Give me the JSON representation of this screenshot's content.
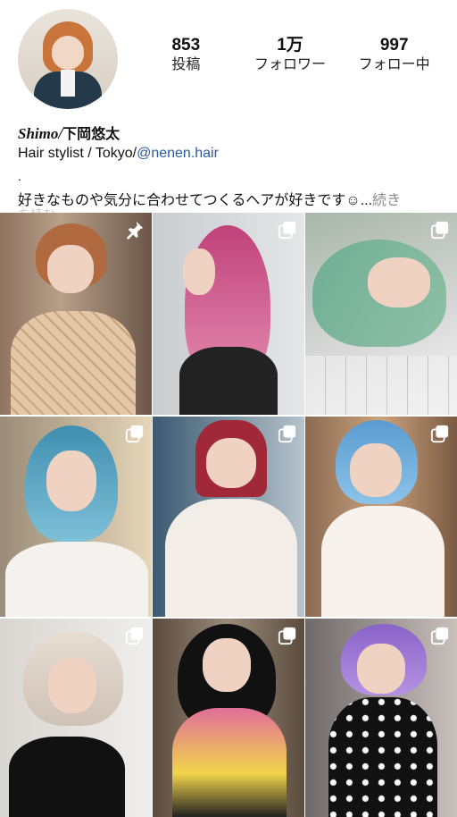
{
  "profile": {
    "stats": [
      {
        "value": "853",
        "label": "投稿"
      },
      {
        "value": "1万",
        "label": "フォロワー"
      },
      {
        "value": "997",
        "label": "フォロー中"
      }
    ],
    "name_latin": "Shimo/",
    "name_jp": "下岡悠太",
    "bio_line1_prefix": "Hair stylist / Tokyo/",
    "bio_line1_link": "@nenen.hair",
    "bio_dot": ".",
    "bio_line2": "好きなものや気分に合わせてつくるヘアが好きです☺︎...",
    "more_label": "続き",
    "cutoff_text": "を読む"
  },
  "grid": {
    "tiles": [
      {
        "icon": "pin-icon"
      },
      {
        "icon": "multi-photo-icon"
      },
      {
        "icon": "multi-photo-icon"
      },
      {
        "icon": "multi-photo-icon"
      },
      {
        "icon": "multi-photo-icon"
      },
      {
        "icon": "multi-photo-icon"
      },
      {
        "icon": "multi-photo-icon"
      },
      {
        "icon": "multi-photo-icon"
      },
      {
        "icon": "multi-photo-icon"
      }
    ]
  },
  "colors": {
    "link": "#2a5b9e",
    "more": "#8a8a8a"
  }
}
